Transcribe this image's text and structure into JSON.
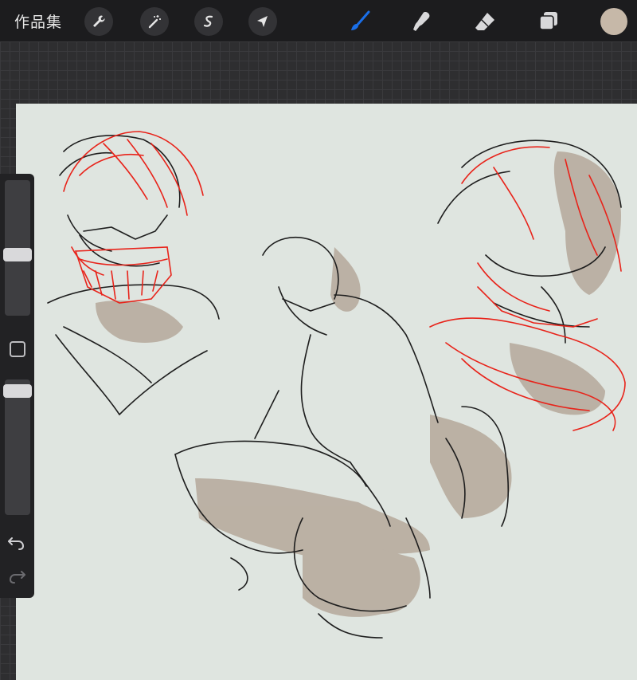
{
  "topbar": {
    "gallery_label": "作品集",
    "tools": [
      "wrench-icon",
      "magic-wand-icon",
      "selection-icon",
      "transform-arrow-icon"
    ],
    "right_tools": [
      "brush-icon",
      "smudge-icon",
      "eraser-icon",
      "layers-icon"
    ],
    "active_tool": "brush-icon",
    "active_color": "#1a6fe8",
    "current_color": "#c6b8a8"
  },
  "sidebar": {
    "size_slider_value": 0.45,
    "opacity_slider_value": 0.95
  },
  "colors": {
    "sketch_red": "#e8231a",
    "sketch_dark": "#1e1e1e",
    "shadow_tone": "#b5a89a",
    "canvas": "#dfe5e0"
  }
}
